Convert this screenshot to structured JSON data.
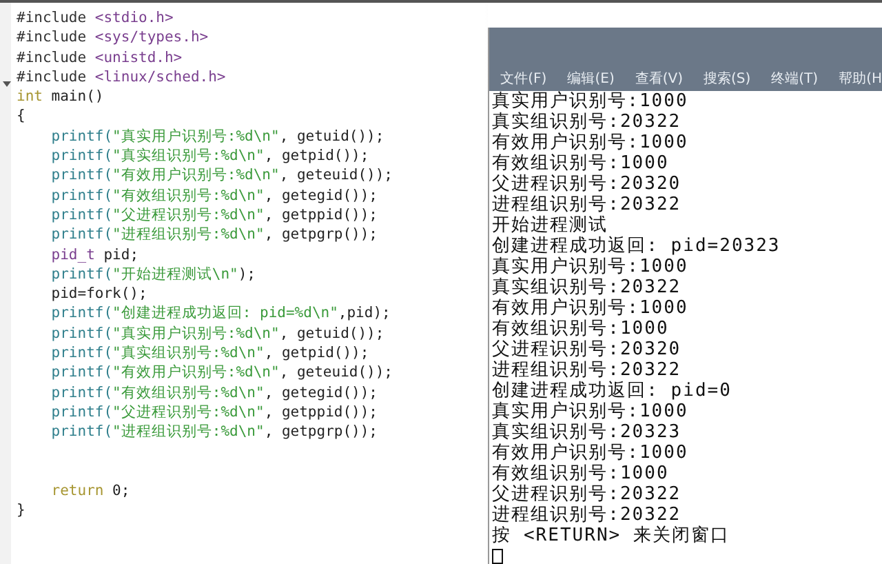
{
  "editor": {
    "lines": [
      [
        {
          "kind": "pre",
          "text": "#include "
        },
        {
          "kind": "inc",
          "text": "<stdio.h>"
        }
      ],
      [
        {
          "kind": "pre",
          "text": "#include "
        },
        {
          "kind": "inc",
          "text": "<sys/types.h>"
        }
      ],
      [
        {
          "kind": "pre",
          "text": "#include "
        },
        {
          "kind": "inc",
          "text": "<unistd.h>"
        }
      ],
      [
        {
          "kind": "pre",
          "text": "#include "
        },
        {
          "kind": "inc",
          "text": "<linux/sched.h>"
        }
      ],
      [
        {
          "kind": "type",
          "text": "int"
        },
        {
          "kind": "plain",
          "text": " main()"
        }
      ],
      [
        {
          "kind": "plain",
          "text": "{"
        }
      ],
      [
        {
          "kind": "fn",
          "text": "    printf("
        },
        {
          "kind": "str",
          "text": "\"真实用户识别号:%d\\n\""
        },
        {
          "kind": "plain",
          "text": ", getuid());"
        }
      ],
      [
        {
          "kind": "fn",
          "text": "    printf("
        },
        {
          "kind": "str",
          "text": "\"真实组识别号:%d\\n\""
        },
        {
          "kind": "plain",
          "text": ", getpid());"
        }
      ],
      [
        {
          "kind": "fn",
          "text": "    printf("
        },
        {
          "kind": "str",
          "text": "\"有效用户识别号:%d\\n\""
        },
        {
          "kind": "plain",
          "text": ", geteuid());"
        }
      ],
      [
        {
          "kind": "fn",
          "text": "    printf("
        },
        {
          "kind": "str",
          "text": "\"有效组识别号:%d\\n\""
        },
        {
          "kind": "plain",
          "text": ", getegid());"
        }
      ],
      [
        {
          "kind": "fn",
          "text": "    printf("
        },
        {
          "kind": "str",
          "text": "\"父进程识别号:%d\\n\""
        },
        {
          "kind": "plain",
          "text": ", getppid());"
        }
      ],
      [
        {
          "kind": "fn",
          "text": "    printf("
        },
        {
          "kind": "str",
          "text": "\"进程组识别号:%d\\n\""
        },
        {
          "kind": "plain",
          "text": ", getpgrp());"
        }
      ],
      [
        {
          "kind": "ptype",
          "text": "    pid_t"
        },
        {
          "kind": "plain",
          "text": " pid;"
        }
      ],
      [
        {
          "kind": "fn",
          "text": "    printf("
        },
        {
          "kind": "str",
          "text": "\"开始进程测试\\n\""
        },
        {
          "kind": "plain",
          "text": ");"
        }
      ],
      [
        {
          "kind": "plain",
          "text": "    pid=fork();"
        }
      ],
      [
        {
          "kind": "fn",
          "text": "    printf("
        },
        {
          "kind": "str",
          "text": "\"创建进程成功返回: pid=%d\\n\""
        },
        {
          "kind": "plain",
          "text": ",pid);"
        }
      ],
      [
        {
          "kind": "fn",
          "text": "    printf("
        },
        {
          "kind": "str",
          "text": "\"真实用户识别号:%d\\n\""
        },
        {
          "kind": "plain",
          "text": ", getuid());"
        }
      ],
      [
        {
          "kind": "fn",
          "text": "    printf("
        },
        {
          "kind": "str",
          "text": "\"真实组识别号:%d\\n\""
        },
        {
          "kind": "plain",
          "text": ", getpid());"
        }
      ],
      [
        {
          "kind": "fn",
          "text": "    printf("
        },
        {
          "kind": "str",
          "text": "\"有效用户识别号:%d\\n\""
        },
        {
          "kind": "plain",
          "text": ", geteuid());"
        }
      ],
      [
        {
          "kind": "fn",
          "text": "    printf("
        },
        {
          "kind": "str",
          "text": "\"有效组识别号:%d\\n\""
        },
        {
          "kind": "plain",
          "text": ", getegid());"
        }
      ],
      [
        {
          "kind": "fn",
          "text": "    printf("
        },
        {
          "kind": "str",
          "text": "\"父进程识别号:%d\\n\""
        },
        {
          "kind": "plain",
          "text": ", getppid());"
        }
      ],
      [
        {
          "kind": "fn",
          "text": "    printf("
        },
        {
          "kind": "str",
          "text": "\"进程组识别号:%d\\n\""
        },
        {
          "kind": "plain",
          "text": ", getpgrp());"
        }
      ],
      [
        {
          "kind": "blank"
        }
      ],
      [
        {
          "kind": "blank"
        }
      ],
      [
        {
          "kind": "type",
          "text": "    return"
        },
        {
          "kind": "plain",
          "text": " 0;"
        }
      ],
      [
        {
          "kind": "plain",
          "text": "}"
        }
      ]
    ]
  },
  "terminal": {
    "menu": [
      "文件(F)",
      "编辑(E)",
      "查看(V)",
      "搜索(S)",
      "终端(T)",
      "帮助(H"
    ],
    "output": [
      "真实用户识别号:1000",
      "真实组识别号:20322",
      "有效用户识别号:1000",
      "有效组识别号:1000",
      "父进程识别号:20320",
      "进程组识别号:20322",
      "开始进程测试",
      "创建进程成功返回: pid=20323",
      "真实用户识别号:1000",
      "真实组识别号:20322",
      "有效用户识别号:1000",
      "有效组识别号:1000",
      "父进程识别号:20320",
      "进程组识别号:20322",
      "创建进程成功返回: pid=0",
      "真实用户识别号:1000",
      "真实组识别号:20323",
      "有效用户识别号:1000",
      "有效组识别号:1000",
      "父进程识别号:20322",
      "进程组识别号:20322",
      "按 <RETURN> 来关闭窗口"
    ]
  }
}
